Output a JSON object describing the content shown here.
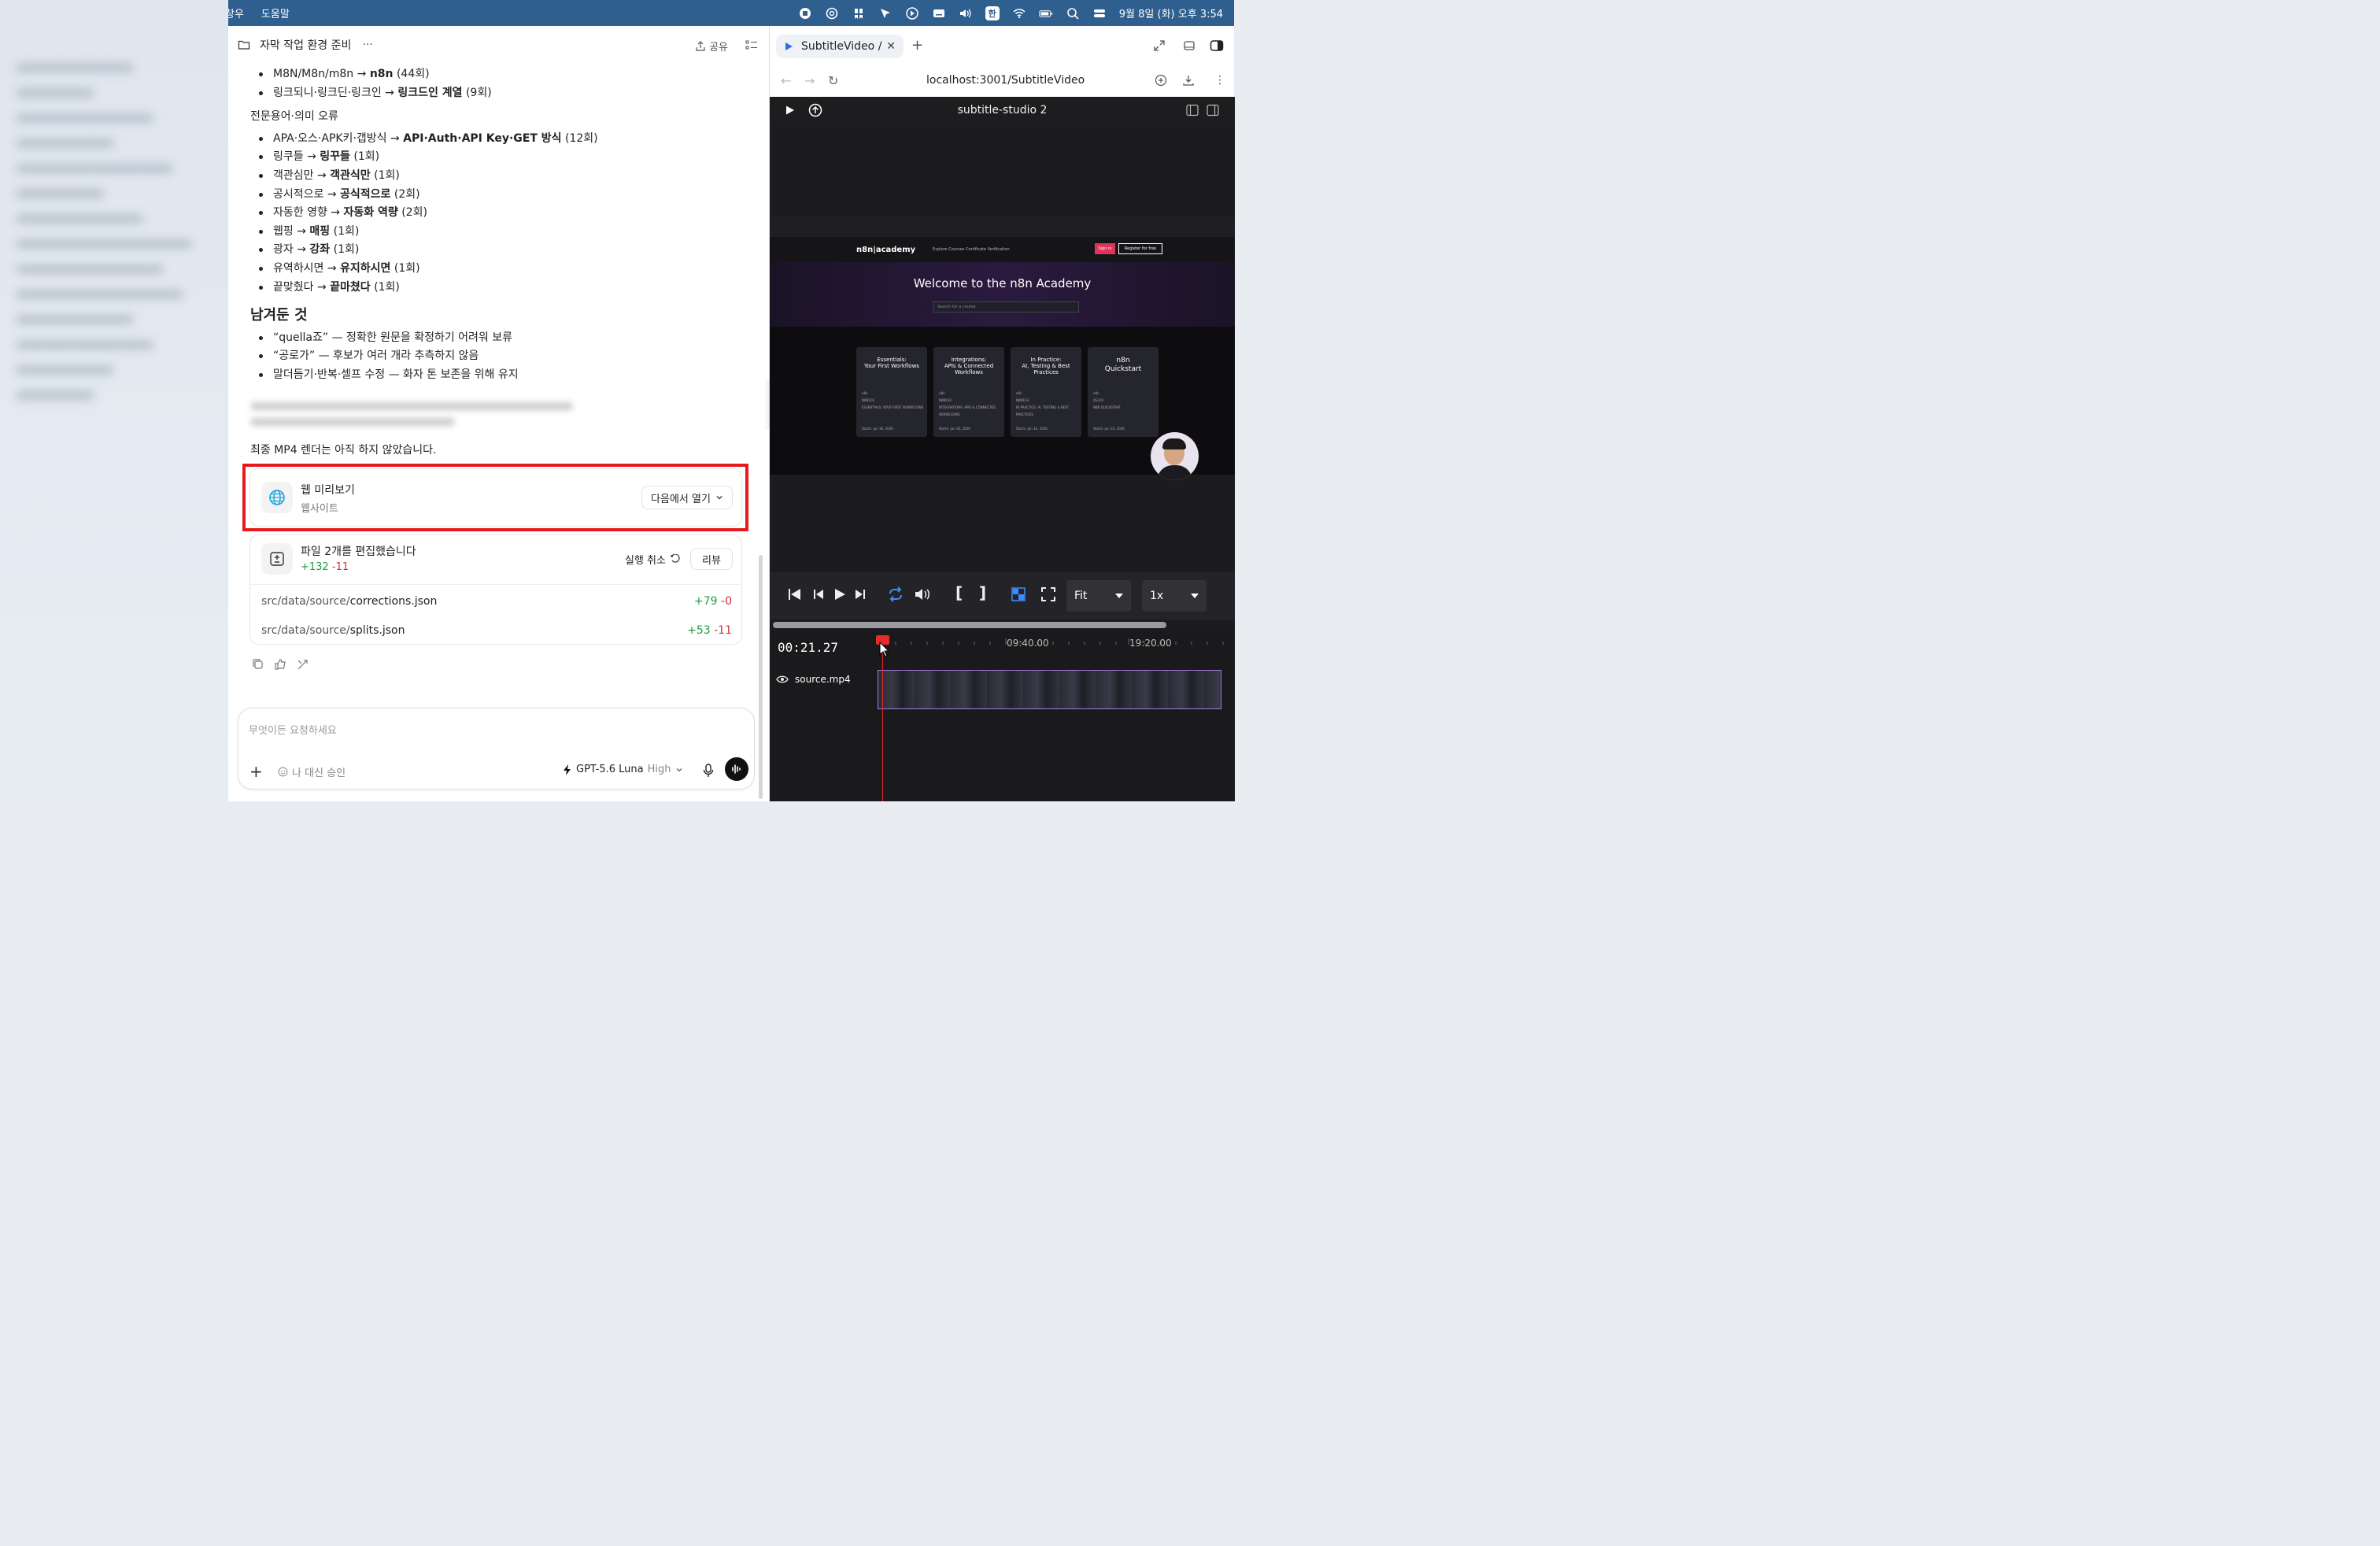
{
  "menubar": {
    "menu_items": [
      "창우",
      "도움말"
    ],
    "date_time": "9월 8일 (화) 오후 3:54",
    "input_method": "한"
  },
  "chat": {
    "title": "자막 작업 환경 준비",
    "share_label": "공유",
    "top_list": [
      {
        "from": "M8N/M8n/m8n → ",
        "to": "n8n",
        "count": " (44회)"
      },
      {
        "from": "링크되니·링크딘·링크인 → ",
        "to": "링크드인 계열",
        "count": " (9회)"
      }
    ],
    "section_terms": "전문용어·의미 오류",
    "terms_list": [
      {
        "from": "APA·오스·APK키·갭방식 → ",
        "to": "API·Auth·API Key·GET 방식",
        "count": " (12회)"
      },
      {
        "from": "링쿠들 → ",
        "to": "링꾸들",
        "count": " (1회)"
      },
      {
        "from": "객관심만 → ",
        "to": "객관식만",
        "count": " (1회)"
      },
      {
        "from": "공시적으로 → ",
        "to": "공식적으로",
        "count": " (2회)"
      },
      {
        "from": "자동한 영향 → ",
        "to": "자동화 역량",
        "count": " (2회)"
      },
      {
        "from": "웹핑 → ",
        "to": "매핑",
        "count": " (1회)"
      },
      {
        "from": "광자 → ",
        "to": "강좌",
        "count": " (1회)"
      },
      {
        "from": "유역하시면 → ",
        "to": "유지하시면",
        "count": " (1회)"
      },
      {
        "from": "끝맞췄다 → ",
        "to": "끝마쳤다",
        "count": " (1회)"
      }
    ],
    "section_left": "남겨둔 것",
    "left_list": [
      "“quella죠” — 정확한 원문을 확정하기 어려워 보류",
      "“공로가” — 후보가 여러 개라 추측하지 않음",
      "말더듬기·반복·셀프 수정 — 화자 톤 보존을 위해 유지"
    ],
    "render_note": "최종 MP4 렌더는 아직 하지 않았습니다.",
    "preview_card": {
      "title": "웹 미리보기",
      "subtitle": "웹사이트",
      "open_label": "다음에서 열기"
    },
    "edit_card": {
      "title": "파일 2개를 편집했습니다",
      "added": "+132",
      "removed": "-11",
      "undo_label": "실행 취소",
      "review_label": "리뷰",
      "files": [
        {
          "dir": "src/data/source/",
          "name": "corrections.json",
          "added": "+79",
          "removed": "-0"
        },
        {
          "dir": "src/data/source/",
          "name": "splits.json",
          "added": "+53",
          "removed": "-11"
        }
      ]
    },
    "composer": {
      "placeholder": "무엇이든 요청하세요",
      "approve_label": "나 대신 승인",
      "model": "GPT-5.6 Luna",
      "level": "High"
    }
  },
  "browser": {
    "tab_title": "SubtitleVideo /",
    "url": "localhost:3001/SubtitleVideo",
    "app_title": "subtitle-studio 2",
    "video": {
      "logo": "n8n|academy",
      "nav_links": "Explore Courses    Certificate Verification",
      "sign_in": "Sign in",
      "register": "Register for free",
      "welcome": "Welcome to the n8n Academy",
      "search_placeholder": "Search for a course",
      "cards": [
        {
          "title": "Essentials:\nYour First Workflows",
          "sub": "n8n\nN8N101\nESSENTIALS: YOUR FIRST WORKFLOWS\n\n\nStarts: Jun 16, 2026"
        },
        {
          "title": "Integrations:\nAPIs & Connected\nWorkflows",
          "sub": "n8n\nN8N102\nINTEGRATIONS: APIS & CONNECTED\nWORKFLOWS\n\nStarts: Jun 16, 2026"
        },
        {
          "title": "In Practice:\nAI, Testing & Best\nPractices",
          "sub": "n8n\nN8N103\nIN PRACTICE: AI, TESTING & BEST\nPRACTICES\n\nStarts: Jun 16, 2026"
        },
        {
          "title": "n8n\nQuickstart",
          "sub": "n8n\nQS101\nN8N QUICKSTART\n\n\nStarts: Jun 16, 2026"
        }
      ]
    },
    "controls": {
      "fit_label": "Fit",
      "speed_label": "1x"
    },
    "timeline": {
      "timecode": "00:21.27",
      "marks": [
        "09:40.00",
        "19:20.00"
      ],
      "track_name": "source.mp4"
    }
  }
}
